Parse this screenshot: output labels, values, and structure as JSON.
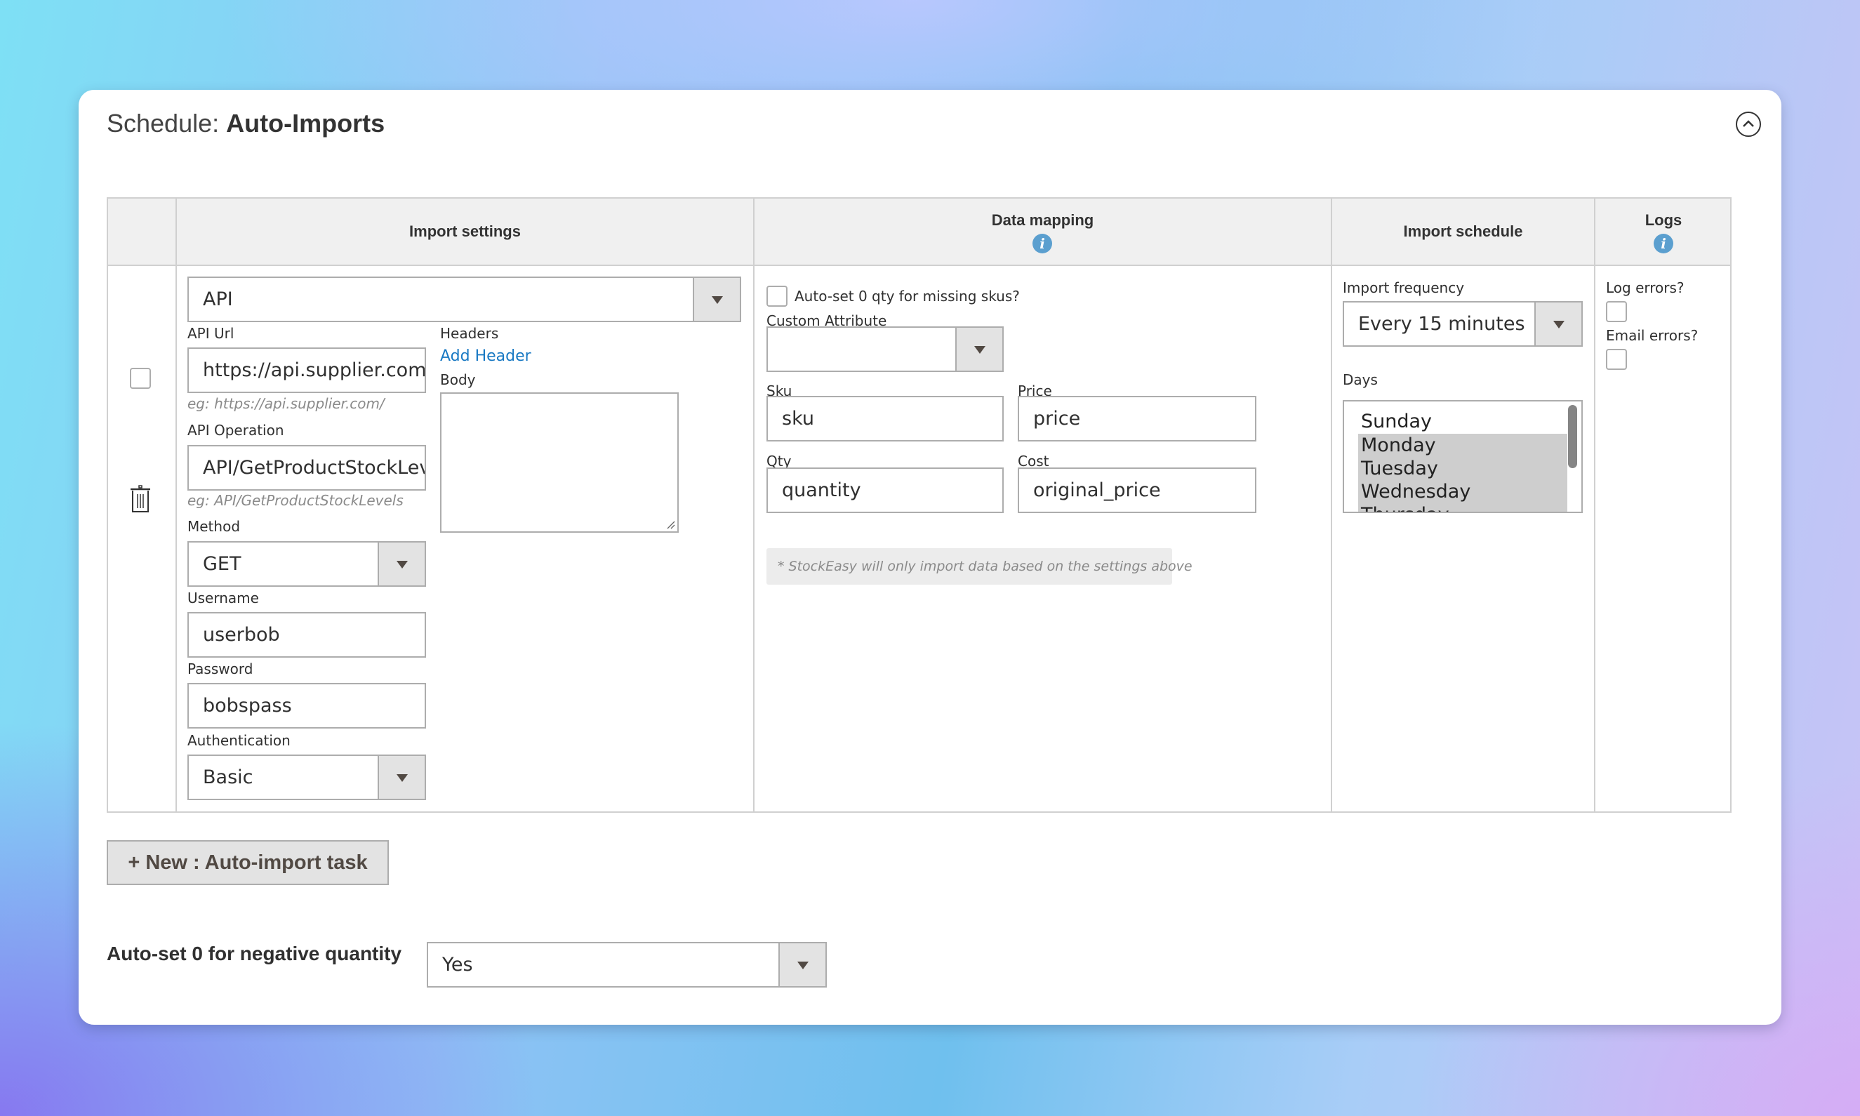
{
  "header": {
    "title_prefix": "Schedule:",
    "title_main": "Auto-Imports",
    "collapse_icon": "chevron-up-circle-icon"
  },
  "table": {
    "columns": [
      {
        "label": ""
      },
      {
        "label": "Import settings"
      },
      {
        "label": "Data mapping",
        "info_icon": "i"
      },
      {
        "label": "Import schedule"
      },
      {
        "label": "Logs",
        "info_icon": "i"
      }
    ],
    "row": {
      "row_select_checked": false,
      "delete_icon": "trash-icon",
      "import_settings": {
        "source_type": "API",
        "api_url_label": "API Url",
        "api_url_value": "https://api.supplier.com/",
        "api_url_hint": "eg: https://api.supplier.com/",
        "api_operation_label": "API Operation",
        "api_operation_value": "API/GetProductStockLevels",
        "api_operation_hint": "eg: API/GetProductStockLevels",
        "method_label": "Method",
        "method_value": "GET",
        "username_label": "Username",
        "username_value": "userbob",
        "password_label": "Password",
        "password_value": "bobspass",
        "authentication_label": "Authentication",
        "authentication_value": "Basic",
        "headers_label": "Headers",
        "add_header_link": "Add Header",
        "body_label": "Body",
        "body_value": ""
      },
      "data_mapping": {
        "auto_zero_missing_label": "Auto-set 0 qty for missing skus?",
        "auto_zero_missing_checked": false,
        "custom_attribute_label": "Custom Attribute",
        "custom_attribute_value": "",
        "sku_label": "Sku",
        "sku_value": "sku",
        "price_label": "Price",
        "price_value": "price",
        "qty_label": "Qty",
        "qty_value": "quantity",
        "cost_label": "Cost",
        "cost_value": "original_price",
        "note": "* StockEasy will only import data based on the settings above"
      },
      "import_schedule": {
        "frequency_label": "Import frequency",
        "frequency_value": "Every 15 minutes",
        "days_label": "Days",
        "days": [
          {
            "label": "Sunday",
            "selected": false
          },
          {
            "label": "Monday",
            "selected": true
          },
          {
            "label": "Tuesday",
            "selected": true
          },
          {
            "label": "Wednesday",
            "selected": true
          },
          {
            "label": "Thursday",
            "selected": true
          }
        ]
      },
      "logs": {
        "log_errors_label": "Log errors?",
        "log_errors_checked": false,
        "email_errors_label": "Email errors?",
        "email_errors_checked": false
      }
    }
  },
  "new_task_button": {
    "icon": "+",
    "label": "New : Auto-import task"
  },
  "negative_quantity": {
    "label": "Auto-set 0 for negative quantity",
    "value": "Yes"
  },
  "colors": {
    "info_icon": "#5b9fcf",
    "link": "#1979c3",
    "header_bg": "#f0f0f0",
    "button_bg": "#e3e3e3"
  }
}
